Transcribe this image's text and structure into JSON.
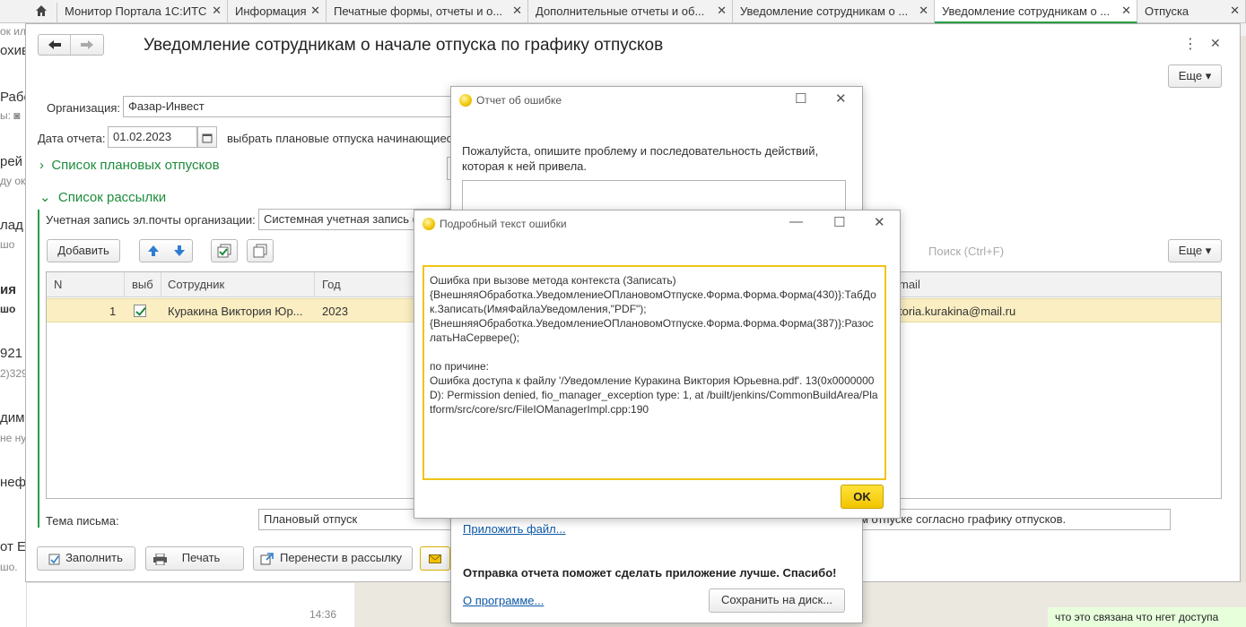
{
  "tabs": [
    {
      "label": "Монитор Портала 1С:ИТС",
      "close": "✕"
    },
    {
      "label": "Информация",
      "close": "✕"
    },
    {
      "label": "Печатные формы, отчеты и о...",
      "close": "✕"
    },
    {
      "label": "Дополнительные отчеты и об...",
      "close": "✕"
    },
    {
      "label": "Уведомление сотрудникам о ...",
      "close": "✕"
    },
    {
      "label": "Уведомление сотрудникам о ...",
      "close": "✕"
    },
    {
      "label": "Отпуска",
      "close": "✕"
    }
  ],
  "left_strip": [
    "ок иль",
    "охив",
    "Рабо",
    "ы: ◙",
    "рей",
    "ду ок",
    "лад",
    "шо",
    "ия",
    "шо",
    "921",
    "2)329",
    "дим",
    "не ну",
    "нефт",
    "от Е",
    "шо.",
    "ия"
  ],
  "chat_time": "14:36",
  "chat_bubble": "что это связана что нгет доступа",
  "form": {
    "title": "Уведомление сотрудникам о начале отпуска по графику отпусков",
    "more_button": "Еще",
    "org_label": "Организация:",
    "org_value": "Фазар-Инвест",
    "date_label": "Дата отчета:",
    "date_value": "01.02.2023",
    "date_hint": "выбрать плановые отпуска начинающиес",
    "section_planned": "Список плановых отпусков",
    "section_mailing": "Список рассылки",
    "email_label": "Учетная запись эл.почты организации:",
    "email_value": "Системная учетная запись (",
    "add_button": "Добавить",
    "search_placeholder": "Поиск (Ctrl+F)",
    "grid_more_button": "Еще",
    "columns": {
      "n": "N",
      "sel": "выб",
      "employee": "Сотрудник",
      "year": "Год",
      "mail": "mail"
    },
    "rows": [
      {
        "n": "1",
        "employee": "Куракина Виктория Юр...",
        "year": "2023",
        "mail": "toria.kurakina@mail.ru"
      }
    ],
    "subject_label": "Тема письма:",
    "subject_value": "Плановый отпуск",
    "body_value": "м отпуске согласно графику отпусков.",
    "fill_button": "Заполнить",
    "print_button": "Печать",
    "transfer_button": "Перенести в рассылку"
  },
  "error_report": {
    "title": "Отчет об ошибке",
    "prompt": "Пожалуйста, опишите проблему и последовательность действий, которая к ней привела.",
    "attach_link": "Приложить файл...",
    "thanks": "Отправка отчета поможет сделать приложение лучше. Спасибо!",
    "about_link": "О программе...",
    "save_button": "Сохранить на диск..."
  },
  "error_detail": {
    "title": "Подробный текст ошибки",
    "text": "Ошибка при вызове метода контекста (Записать)\n{ВнешняяОбработка.УведомлениеОПлановомОтпуске.Форма.Форма.Форма(430)}:ТабДок.Записать(ИмяФайлаУведомления,\"PDF\");\n{ВнешняяОбработка.УведомлениеОПлановомОтпуске.Форма.Форма.Форма(387)}:РазослатьНаСервере();\n\nпо причине:\nОшибка доступа к файлу '/Уведомление Куракина Виктория Юрьевна.pdf'. 13(0x0000000D): Permission denied, fio_manager_exception type: 1, at /built/jenkins/CommonBuildArea/Platform/src/core/src/FileIOManagerImpl.cpp:190",
    "ok_button": "OK"
  },
  "colors": {
    "accent_green": "#1d8c3b",
    "row_highlight": "#fbeec2",
    "ok_yellow": "#f5d000",
    "link_blue": "#0b57a6"
  }
}
